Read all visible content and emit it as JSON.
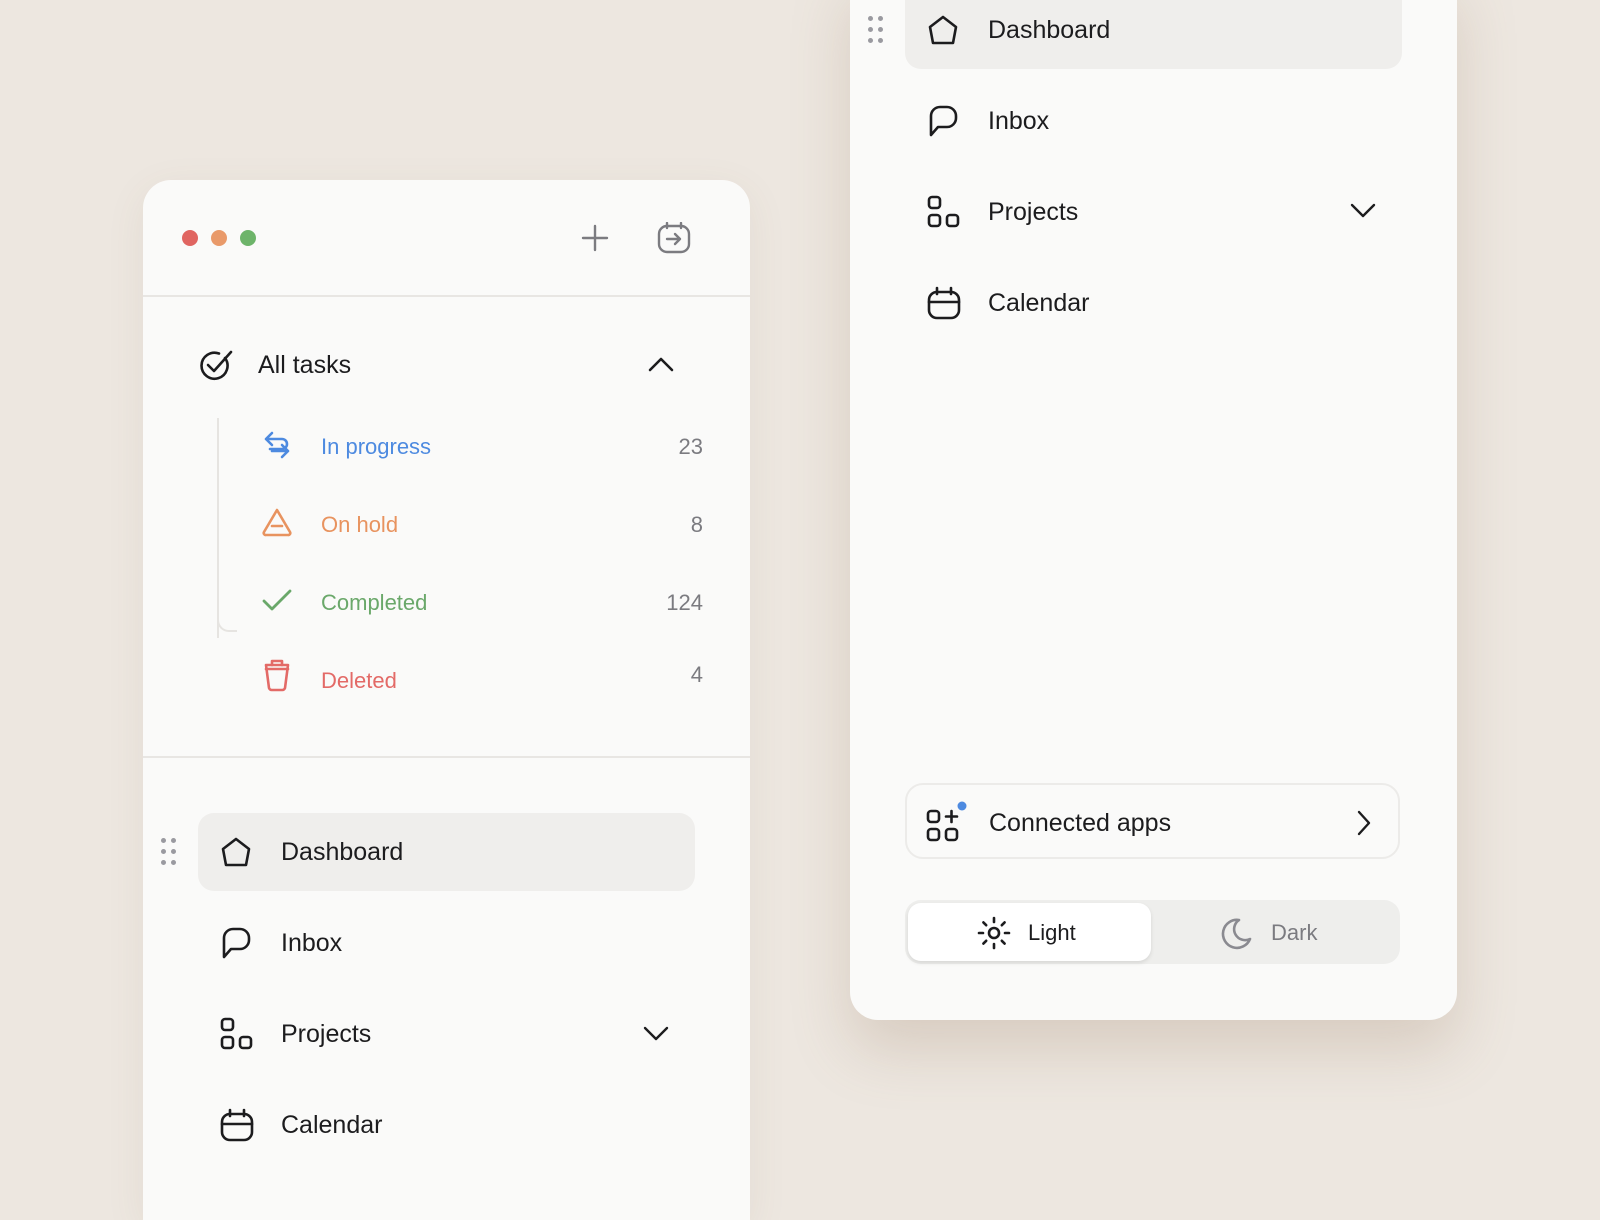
{
  "colors": {
    "close": "#e06561",
    "minimize": "#e99a6a",
    "maximize": "#6db46a",
    "in_progress": "#4d8ae0",
    "on_hold": "#e8935f",
    "completed": "#6aa86a",
    "deleted": "#e36a67",
    "notify_dot": "#4d8ae0"
  },
  "left": {
    "window_controls": [
      "close-dot",
      "minimize-dot",
      "maximize-dot"
    ],
    "toolbar": {
      "new_icon": "plus-icon",
      "export_icon": "export-arrow-icon"
    },
    "tasks": {
      "header": {
        "label": "All tasks",
        "icon": "check-circle-icon",
        "toggle_icon": "chevron-up-icon"
      },
      "statuses": [
        {
          "label": "In progress",
          "count": "23",
          "icon": "repeat-arrows-icon"
        },
        {
          "label": "On hold",
          "count": "8",
          "icon": "warning-triangle-icon"
        },
        {
          "label": "Completed",
          "count": "124",
          "icon": "checkmark-icon"
        },
        {
          "label": "Deleted",
          "count": "4",
          "icon": "trash-icon"
        }
      ]
    },
    "nav": [
      {
        "label": "Dashboard",
        "icon": "home-icon",
        "active": true
      },
      {
        "label": "Inbox",
        "icon": "chat-bubble-icon"
      },
      {
        "label": "Projects",
        "icon": "grid-icon",
        "has_dropdown": true
      },
      {
        "label": "Calendar",
        "icon": "calendar-icon"
      }
    ]
  },
  "right": {
    "nav": [
      {
        "label": "Dashboard",
        "icon": "home-icon",
        "active": true
      },
      {
        "label": "Inbox",
        "icon": "chat-bubble-icon"
      },
      {
        "label": "Projects",
        "icon": "grid-icon",
        "has_dropdown": true
      },
      {
        "label": "Calendar",
        "icon": "calendar-icon"
      }
    ],
    "connected_apps": {
      "label": "Connected apps",
      "icon": "apps-add-icon",
      "arrow_icon": "chevron-right-icon"
    },
    "theme": {
      "options": [
        {
          "label": "Light",
          "icon": "sun-icon",
          "selected": true
        },
        {
          "label": "Dark",
          "icon": "moon-icon",
          "selected": false
        }
      ]
    }
  }
}
